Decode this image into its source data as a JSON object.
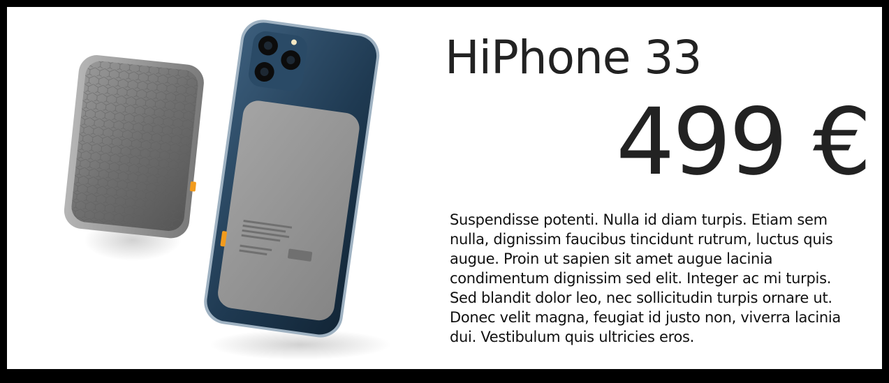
{
  "product": {
    "name": "HiPhone 33",
    "price": "499 €",
    "description": "Suspendisse potenti. Nulla id diam turpis. Etiam sem nulla, dignissim faucibus tincidunt rutrum, luctus quis augue. Proin ut sapien sit amet augue lacinia condimentum dignissim sed elit. Integer ac mi turpis. Sed blandit dolor leo, nec sollicitudin turpis ornare ut. Donec velit magna, feugiat id justo non, viverra lacinia dui. Vestibulum quis ultricies eros.",
    "image": {
      "icon": "smartphone-with-powerbank-image"
    }
  },
  "colors": {
    "frame": "#000000",
    "background": "#ffffff",
    "text": "#222222",
    "phone_blue": "#1f3a52",
    "battery_gray": "#8c8c8c",
    "accent_orange": "#f29b1d"
  }
}
